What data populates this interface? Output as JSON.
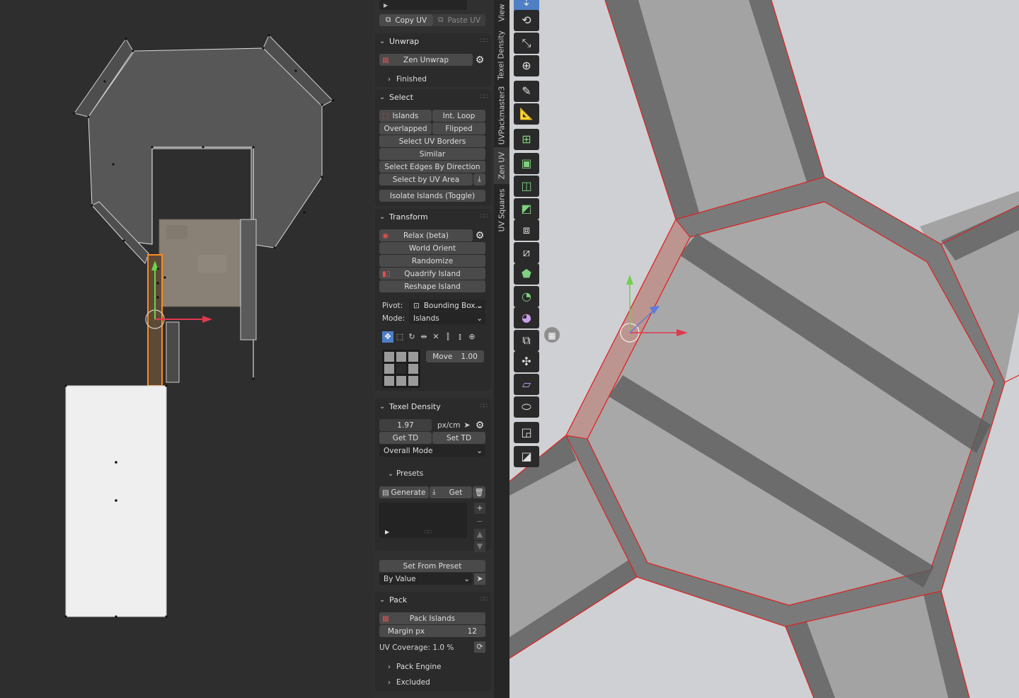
{
  "colors": {
    "panel_bg": "#303030",
    "button": "#4a4a4a",
    "accent_blue": "#4f7fc5",
    "uv_edge": "#ff3030",
    "orange_select": "#ff8a1e"
  },
  "uv_panel": {
    "copy_uv": "Copy UV",
    "paste_uv": "Paste UV",
    "unwrap": {
      "header": "Unwrap",
      "zen_unwrap": "Zen Unwrap",
      "finished": "Finished"
    },
    "select": {
      "header": "Select",
      "islands": "Islands",
      "int_loop": "Int. Loop",
      "overlapped": "Overlapped",
      "flipped": "Flipped",
      "select_uv_borders": "Select UV Borders",
      "similar": "Similar",
      "select_edges_by_direction": "Select Edges By Direction",
      "select_by_uv_area": "Select by UV Area",
      "isolate_islands": "Isolate Islands (Toggle)"
    },
    "transform": {
      "header": "Transform",
      "relax": "Relax (beta)",
      "world_orient": "World Orient",
      "randomize": "Randomize",
      "quadrify": "Quadrify Island",
      "reshape": "Reshape Island",
      "pivot_label": "Pivot:",
      "pivot_value": "Bounding Box...",
      "mode_label": "Mode:",
      "mode_value": "Islands",
      "move_label": "Move",
      "move_value": "1.00"
    },
    "texel_density": {
      "header": "Texel Density",
      "value": "1.97",
      "unit": "px/cm",
      "get_td": "Get TD",
      "set_td": "Set TD",
      "mode": "Overall Mode",
      "presets": "Presets",
      "generate": "Generate",
      "get": "Get",
      "set_from_preset": "Set From Preset",
      "by_value": "By Value"
    },
    "pack": {
      "header": "Pack",
      "pack_islands": "Pack Islands",
      "margin_label": "Margin px",
      "margin_value": "12",
      "uv_coverage": "UV Coverage: 1.0 %",
      "pack_engine": "Pack Engine",
      "excluded": "Excluded"
    }
  },
  "side_tabs": [
    "View",
    "Texel Density",
    "UVPackmaster3",
    "Zen UV",
    "UV Squares"
  ],
  "toolbar_icons": [
    "cursor-icon",
    "rotate-icon",
    "scale-icon",
    "transform-icon",
    "annotate-icon",
    "measure-icon",
    "add-cube-icon",
    "extrude-icon",
    "inset-icon",
    "bevel-icon",
    "loop-cut-icon",
    "knife-icon",
    "poly-build-icon",
    "spin-icon",
    "smooth-icon",
    "edge-slide-icon",
    "shrink-fatten-icon",
    "shear-icon",
    "rip-icon",
    "to-sphere-icon",
    "uv-square-icon"
  ]
}
